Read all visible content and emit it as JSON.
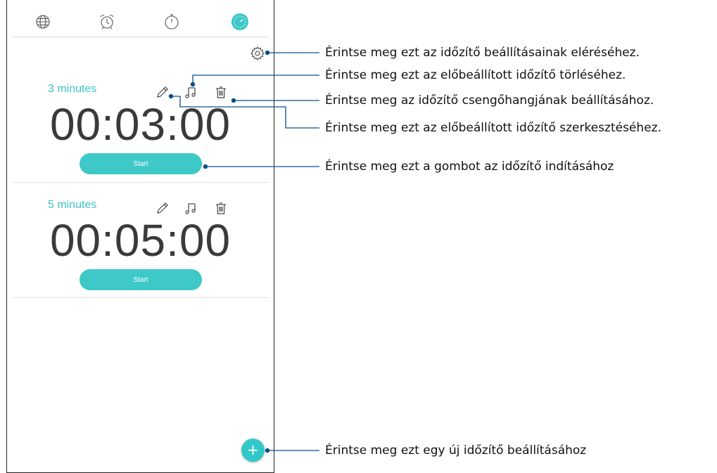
{
  "tabs": [
    {
      "name": "world-clock",
      "icon": "globe-icon"
    },
    {
      "name": "alarm",
      "icon": "alarm-clock-icon"
    },
    {
      "name": "stopwatch",
      "icon": "stopwatch-icon"
    },
    {
      "name": "timer",
      "icon": "timer-icon",
      "active": true
    }
  ],
  "settings_icon": "gear-icon",
  "timers": [
    {
      "name": "3 minutes",
      "time": "00:03:00",
      "start_label": "Start"
    },
    {
      "name": "5 minutes",
      "time": "00:05:00",
      "start_label": "Start"
    }
  ],
  "fab": {
    "label": "+",
    "icon": "plus-icon"
  },
  "annotations": {
    "settings": "Érintse meg ezt az időzítő beállításainak eléréséhez.",
    "delete": "Érintse meg ezt az előbeállított időzítő törléséhez.",
    "ringtone": "Érintse meg az időzítő csengőhangjának beállításához.",
    "edit": "Érintse meg ezt az előbeállított időzítő szerkesztéséhez.",
    "start": "Érintse meg ezt a gombot az időzítő indításához",
    "add": "Érintse meg ezt egy új időzítő beállításához"
  },
  "colors": {
    "accent": "#3ec8c8",
    "callout": "#0b4f8a",
    "text": "#3a3a3a"
  }
}
